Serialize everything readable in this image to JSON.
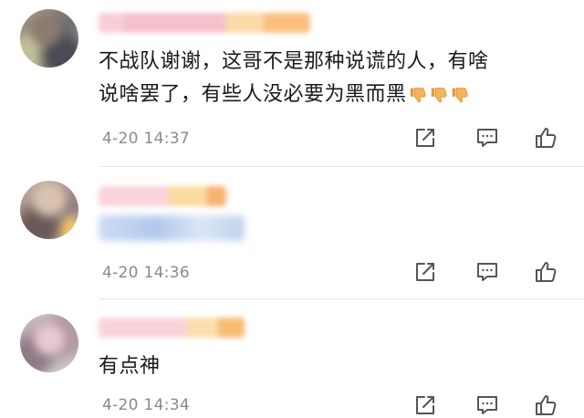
{
  "comments": [
    {
      "text_lines": [
        "不战队谢谢，这哥不是那种说谎的人，有啥",
        "说啥罢了，有些人没必要为黑而黑"
      ],
      "emojis": [
        "thumbs-down-icon",
        "thumbs-down-icon",
        "thumbs-down-icon"
      ],
      "time": "4-20 14:37"
    },
    {
      "text_lines": [],
      "time": "4-20 14:36"
    },
    {
      "text_lines": [
        "有点神"
      ],
      "time": "4-20 14:34"
    }
  ],
  "icons": {
    "share": "share-icon",
    "reply": "comment-icon",
    "like": "thumbs-up-icon"
  },
  "colors": {
    "text": "#1a1a1a",
    "meta": "#8a8a8a",
    "icon": "#555555",
    "emoji": "#f3b35b"
  }
}
